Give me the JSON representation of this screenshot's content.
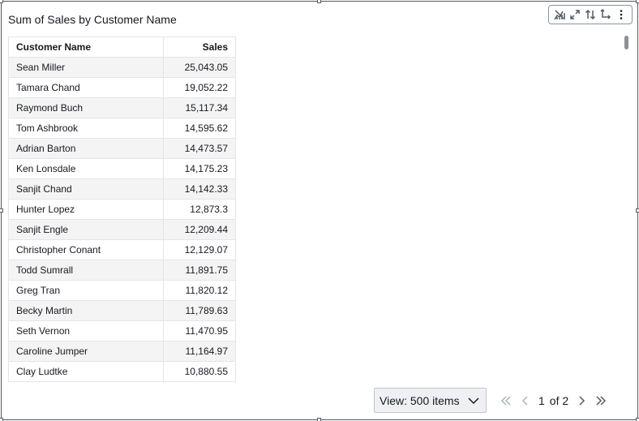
{
  "visual": {
    "title": "Sum of Sales by Customer Name"
  },
  "toolbar": {
    "icons": [
      "chart-type-icon",
      "expand-icon",
      "sort-icon",
      "swap-icon",
      "more-options-icon"
    ]
  },
  "table": {
    "columns": [
      "Customer Name",
      "Sales"
    ],
    "rows": [
      {
        "name": "Sean Miller",
        "sales": "25,043.05"
      },
      {
        "name": "Tamara Chand",
        "sales": "19,052.22"
      },
      {
        "name": "Raymond Buch",
        "sales": "15,117.34"
      },
      {
        "name": "Tom Ashbrook",
        "sales": "14,595.62"
      },
      {
        "name": "Adrian Barton",
        "sales": "14,473.57"
      },
      {
        "name": "Ken Lonsdale",
        "sales": "14,175.23"
      },
      {
        "name": "Sanjit Chand",
        "sales": "14,142.33"
      },
      {
        "name": "Hunter Lopez",
        "sales": "12,873.3"
      },
      {
        "name": "Sanjit Engle",
        "sales": "12,209.44"
      },
      {
        "name": "Christopher Conant",
        "sales": "12,129.07"
      },
      {
        "name": "Todd Sumrall",
        "sales": "11,891.75"
      },
      {
        "name": "Greg Tran",
        "sales": "11,820.12"
      },
      {
        "name": "Becky Martin",
        "sales": "11,789.63"
      },
      {
        "name": "Seth Vernon",
        "sales": "11,470.95"
      },
      {
        "name": "Caroline Jumper",
        "sales": "11,164.97"
      },
      {
        "name": "Clay Ludtke",
        "sales": "10,880.55"
      },
      {
        "name": "",
        "sales": ""
      }
    ]
  },
  "pagination": {
    "view_label": "View: 500 items",
    "current_page": "1",
    "of_label": "of 2"
  }
}
